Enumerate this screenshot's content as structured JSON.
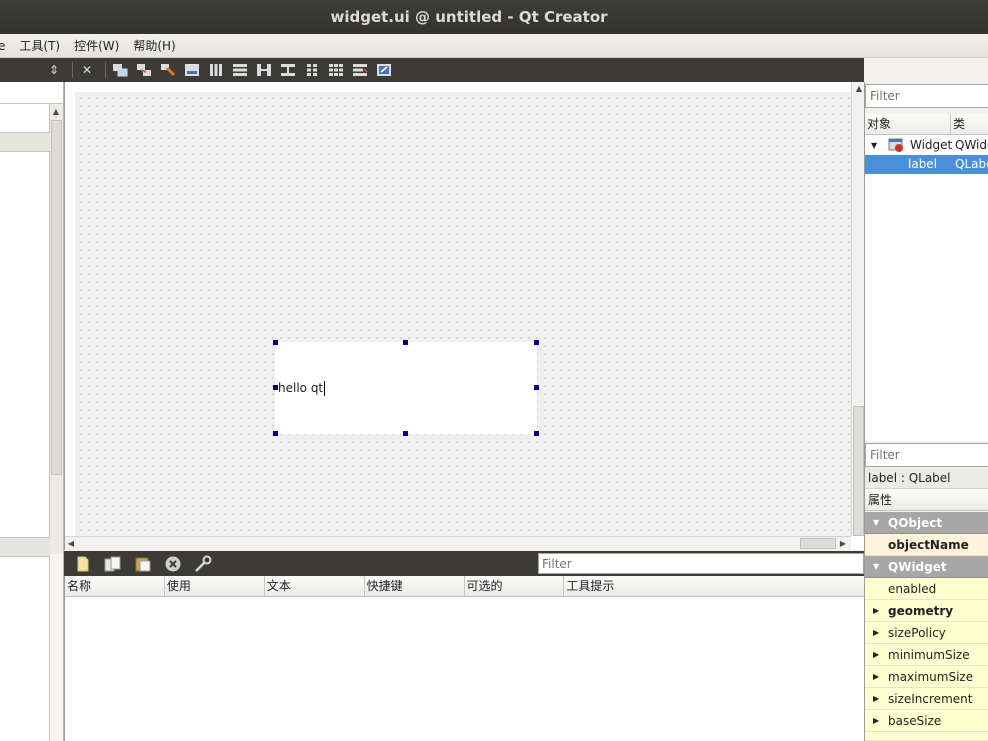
{
  "window": {
    "title": "widget.ui @ untitled - Qt Creator"
  },
  "menubar": {
    "items": [
      {
        "label": "e"
      },
      {
        "label": "工具(T)"
      },
      {
        "label": "控件(W)"
      },
      {
        "label": "帮助(H)"
      }
    ]
  },
  "toolbar": {
    "icons": [
      "combo-arrows-icon",
      "close-icon",
      "edit-widgets-icon",
      "edit-signals-icon",
      "edit-buddies-icon",
      "edit-tab-order-icon",
      "layout-horizontal-icon",
      "layout-vertical-icon",
      "layout-h-splitter-icon",
      "layout-v-splitter-icon",
      "layout-form-icon",
      "layout-grid-icon",
      "break-layout-icon",
      "adjust-size-icon"
    ]
  },
  "canvas": {
    "label_text": "hello qt"
  },
  "action_editor": {
    "filter_placeholder": "Filter",
    "columns": [
      "名称",
      "使用",
      "文本",
      "快捷键",
      "可选的",
      "工具提示"
    ]
  },
  "object_inspector": {
    "filter_placeholder": "Filter",
    "col_object": "对象",
    "col_class": "类",
    "rows": [
      {
        "object": "Widget",
        "class": "QWidg"
      },
      {
        "object": "label",
        "class": "QLabe"
      }
    ]
  },
  "property_editor": {
    "filter_placeholder": "Filter",
    "title": "label : QLabel",
    "header": "属性",
    "rows": [
      {
        "name": "QObject"
      },
      {
        "name": "objectName"
      },
      {
        "name": "QWidget"
      },
      {
        "name": "enabled"
      },
      {
        "name": "geometry"
      },
      {
        "name": "sizePolicy"
      },
      {
        "name": "minimumSize"
      },
      {
        "name": "maximumSize"
      },
      {
        "name": "sizeIncrement"
      },
      {
        "name": "baseSize"
      }
    ],
    "colors": {
      "group": "#a7a7a7",
      "row_highlight": "#fff3dc",
      "row_yellow": "#ffffcf"
    }
  },
  "colors": {
    "titlebar": "#3c3b37",
    "selection": "#4a90d9",
    "handle": "#000080"
  }
}
